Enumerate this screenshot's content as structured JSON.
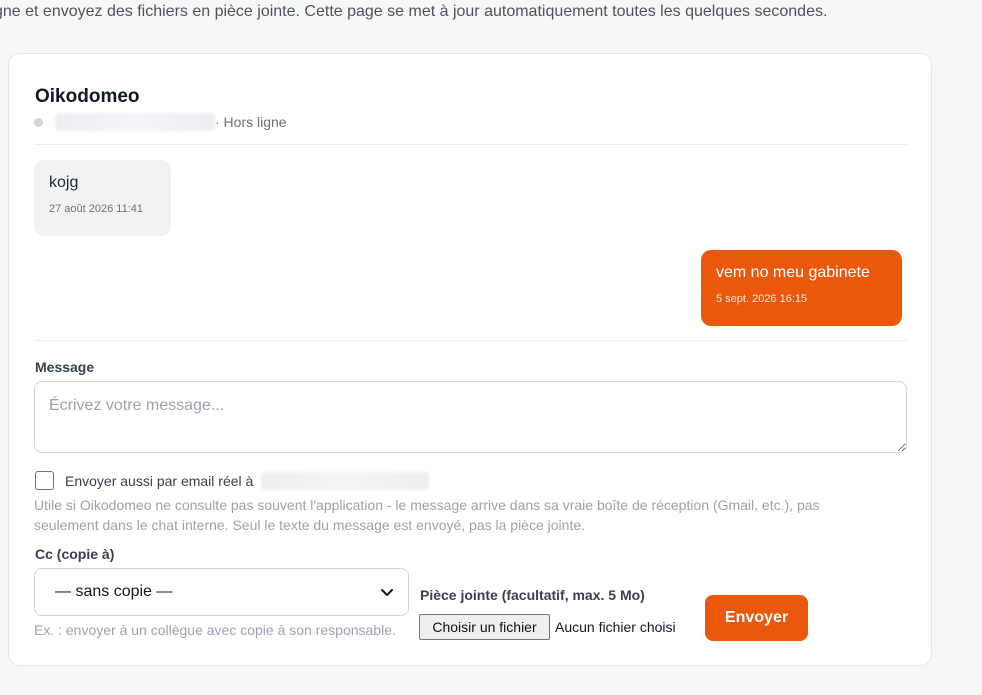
{
  "intro": {
    "text": "gne et envoyez des fichiers en pièce jointe. Cette page se met à jour automatiquement toutes les quelques secondes."
  },
  "header": {
    "contact_name": "Oikodomeo",
    "status": "· Hors ligne"
  },
  "messages": [
    {
      "direction": "incoming",
      "text": "kojg",
      "time": "27 août 2026 11:41"
    },
    {
      "direction": "outgoing",
      "text": "vem no meu gabinete",
      "time": "5 sept. 2026 16:15"
    }
  ],
  "composer": {
    "message_label": "Message",
    "message_placeholder": "Écrivez votre message...",
    "email_copy_label": "Envoyer aussi par email réel à",
    "email_copy_checked": false,
    "email_copy_help": "Utile si Oikodomeo ne consulte pas souvent l'application - le message arrive dans sa vraie boîte de réception (Gmail, etc.), pas seulement dans le chat interne. Seul le texte du message est envoyé, pas la pièce jointe.",
    "cc_label": "Cc (copie à)",
    "cc_selected": "— sans copie —",
    "cc_hint": "Ex. : envoyer à un collègue avec copie à son responsable.",
    "attachment_label": "Pièce jointe (facultatif, max. 5 Mo)",
    "file_button": "Choisir un fichier",
    "file_status": "Aucun fichier choisi",
    "send_button": "Envoyer"
  },
  "colors": {
    "accent": "#ea580c",
    "incoming_bubble": "#f1f2f4",
    "status_dot": "#d1d5db"
  },
  "icons": {
    "status": "status-dot-icon",
    "select": "chevron-down-icon",
    "resize": "resize-grip-icon"
  }
}
